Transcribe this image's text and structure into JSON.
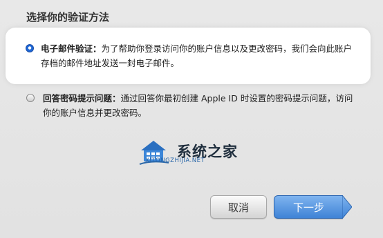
{
  "header": {
    "title": "选择你的验证方法"
  },
  "options": [
    {
      "label": "电子邮件验证：",
      "description": "为了帮助你登录访问你的账户信息以及更改密码，我们会向此账户存档的邮件地址发送一封电子邮件。",
      "selected": true
    },
    {
      "label": "回答密码提示问题：",
      "description": "通过回答你最初创建 Apple ID 时设置的密码提示问题，访问你的账户信息并更改密码。",
      "selected": false
    }
  ],
  "watermark": {
    "title": "系统之家",
    "subtitle": "XITONGZHIJIA.NET"
  },
  "buttons": {
    "cancel_label": "取消",
    "next_label": "下一步"
  },
  "colors": {
    "accent": "#3f83d6",
    "radio_selected": "#1e67d6"
  },
  "icons": {
    "watermark_logo": "house-logo-icon",
    "next_arrow": "arrow-right-icon"
  }
}
